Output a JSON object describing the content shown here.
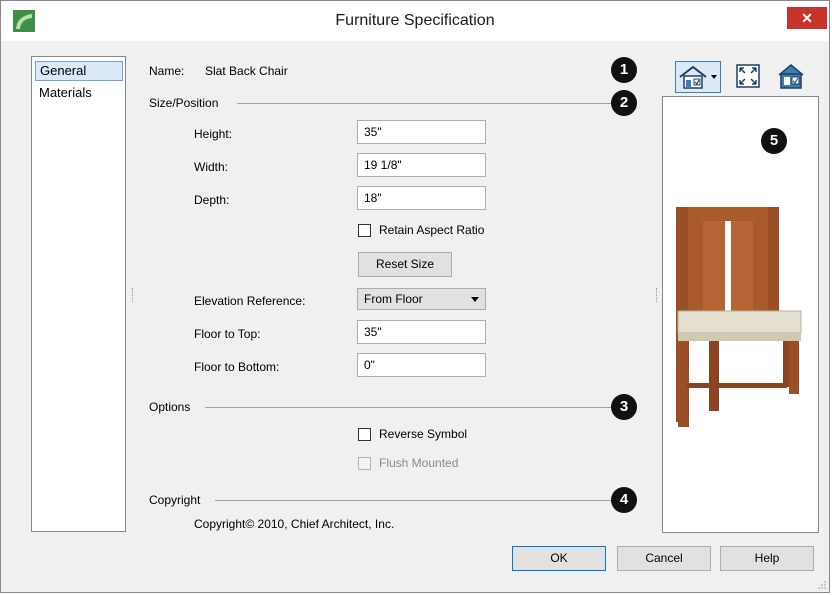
{
  "window": {
    "title": "Furniture Specification",
    "close_label": "✕"
  },
  "sidebar": {
    "items": [
      {
        "label": "General",
        "selected": true
      },
      {
        "label": "Materials",
        "selected": false
      }
    ]
  },
  "name_row": {
    "label": "Name:",
    "value": "Slat Back Chair"
  },
  "size_position": {
    "heading": "Size/Position",
    "height": {
      "label": "Height:",
      "value": "35\""
    },
    "width": {
      "label": "Width:",
      "value": "19 1/8\""
    },
    "depth": {
      "label": "Depth:",
      "value": "18\""
    },
    "retain_aspect": {
      "label": "Retain Aspect Ratio",
      "checked": false
    },
    "reset_size_label": "Reset Size",
    "elevation_reference": {
      "label": "Elevation Reference:",
      "value": "From Floor"
    },
    "floor_to_top": {
      "label": "Floor to Top:",
      "value": "35\""
    },
    "floor_to_bottom": {
      "label": "Floor to Bottom:",
      "value": "0\""
    }
  },
  "options": {
    "heading": "Options",
    "reverse_symbol": {
      "label": "Reverse Symbol",
      "checked": false
    },
    "flush_mounted": {
      "label": "Flush Mounted",
      "checked": false,
      "disabled": true
    }
  },
  "copyright": {
    "heading": "Copyright",
    "text": "Copyright© 2010, Chief Architect, Inc."
  },
  "callouts": [
    "1",
    "2",
    "3",
    "4",
    "5"
  ],
  "toolbar": {
    "icons": [
      "house-view-icon",
      "fit-window-icon",
      "preview-settings-icon"
    ]
  },
  "buttons": {
    "ok": "OK",
    "cancel": "Cancel",
    "help": "Help"
  },
  "colors": {
    "accent": "#0078d7",
    "close": "#c8342c",
    "chair_wood": "#a85a2c",
    "chair_seat": "#e4e0cf"
  }
}
